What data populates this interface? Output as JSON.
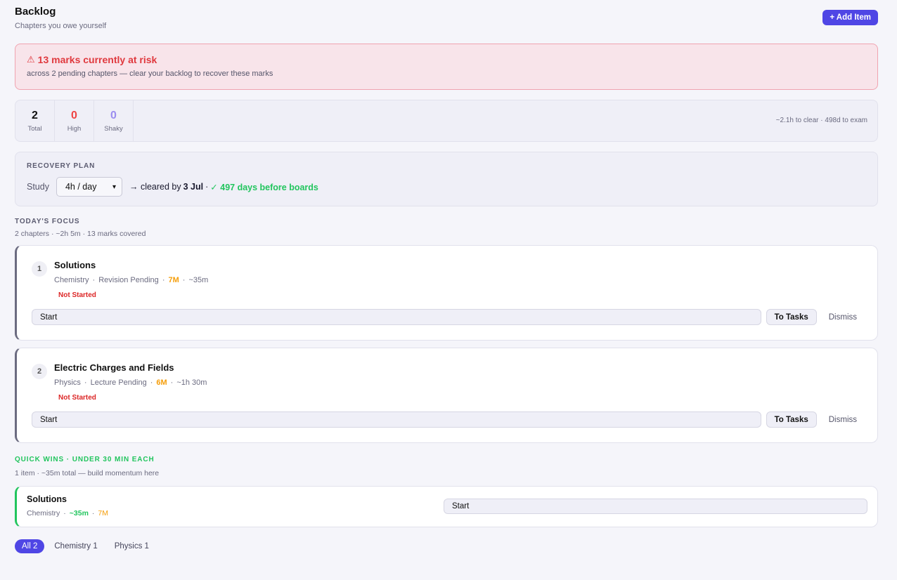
{
  "header": {
    "title": "Backlog",
    "subtitle": "Chapters you owe yourself",
    "add_button": "+ Add Item"
  },
  "risk": {
    "icon": "warning-icon",
    "title": "13 marks currently at risk",
    "subtitle": "across 2 pending chapters — clear your backlog to recover these marks"
  },
  "stats": {
    "total": {
      "value": "2",
      "label": "Total"
    },
    "high": {
      "value": "0",
      "label": "High"
    },
    "shaky": {
      "value": "0",
      "label": "Shaky"
    },
    "note": "~2.1h to clear · 498d to exam"
  },
  "recovery": {
    "label": "RECOVERY PLAN",
    "study_label": "Study",
    "hours_value": "4h / day",
    "cleared_prefix": "→ cleared by",
    "cleared_date": "3 Jul",
    "separator": "·",
    "days_before": "✓ 497 days before boards"
  },
  "focus": {
    "label": "TODAY'S FOCUS",
    "subtitle": "2 chapters · ~2h 5m · 13 marks covered",
    "tasks": [
      {
        "num": "1",
        "title": "Solutions",
        "subject": "Chemistry",
        "type": "Revision Pending",
        "marks": "7M",
        "time": "~35m",
        "status": "Not Started",
        "start_label": "Start",
        "to_tasks_label": "To Tasks",
        "dismiss_label": "Dismiss"
      },
      {
        "num": "2",
        "title": "Electric Charges and Fields",
        "subject": "Physics",
        "type": "Lecture Pending",
        "marks": "6M",
        "time": "~1h 30m",
        "status": "Not Started",
        "start_label": "Start",
        "to_tasks_label": "To Tasks",
        "dismiss_label": "Dismiss"
      }
    ]
  },
  "quick_wins": {
    "label": "QUICK WINS · UNDER 30 MIN EACH",
    "subtitle": "1 item · ~35m total — build momentum here",
    "item": {
      "title": "Solutions",
      "subject": "Chemistry",
      "time": "~35m",
      "marks": "7M",
      "start_label": "Start"
    }
  },
  "filters": [
    {
      "label": "All 2",
      "active": true
    },
    {
      "label": "Chemistry 1",
      "active": false
    },
    {
      "label": "Physics 1",
      "active": false
    }
  ],
  "colors": {
    "accent": "#4f46e5",
    "danger": "#ef4444",
    "success": "#22c55e",
    "warning": "#f59e0b"
  }
}
